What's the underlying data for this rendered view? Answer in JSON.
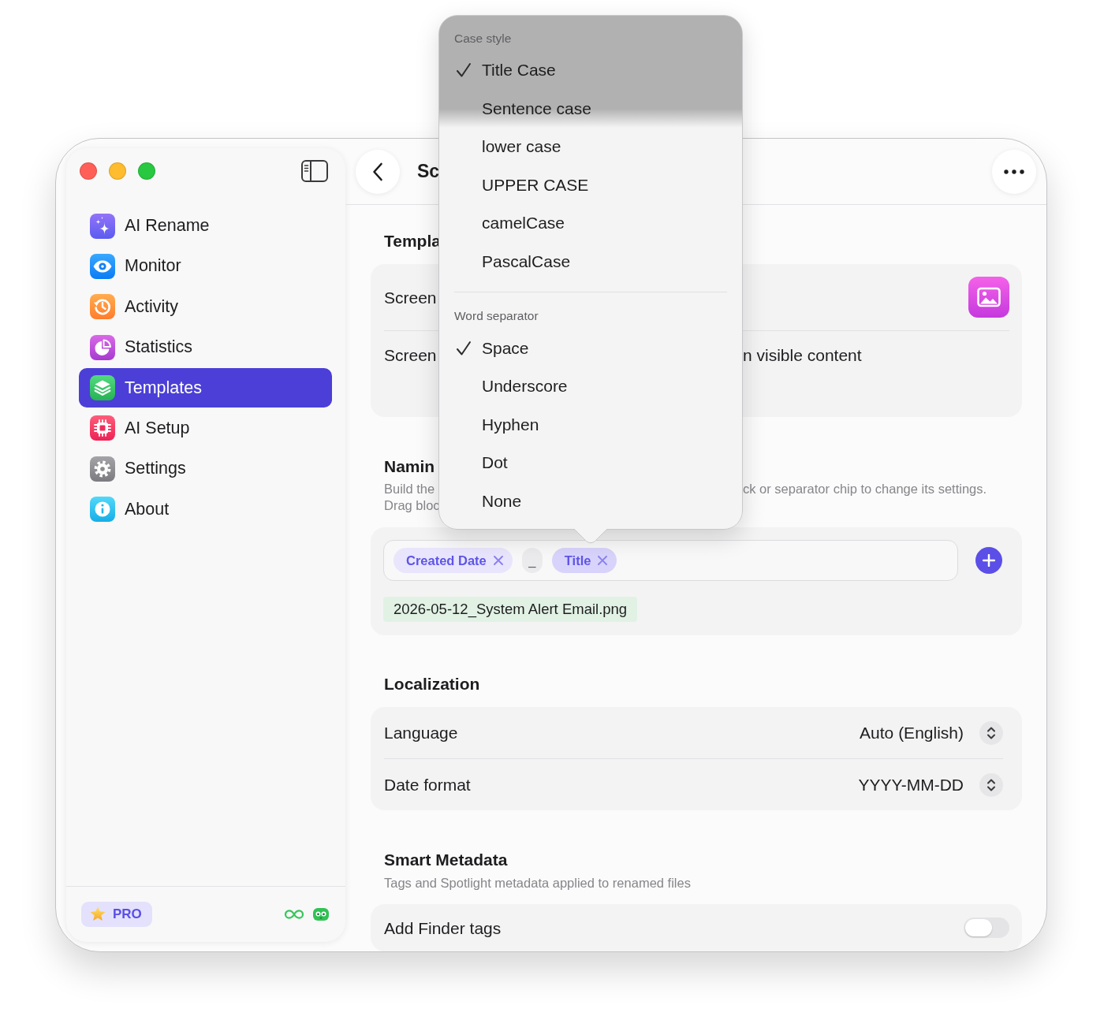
{
  "sidebar": {
    "items": [
      {
        "label": "AI Rename",
        "selected": false
      },
      {
        "label": "Monitor",
        "selected": false
      },
      {
        "label": "Activity",
        "selected": false
      },
      {
        "label": "Statistics",
        "selected": false
      },
      {
        "label": "Templates",
        "selected": true
      },
      {
        "label": "AI Setup",
        "selected": false
      },
      {
        "label": "Settings",
        "selected": false
      },
      {
        "label": "About",
        "selected": false
      }
    ],
    "badge": "PRO"
  },
  "header": {
    "title": "Sc"
  },
  "template_section": {
    "title": "Templa",
    "rows": [
      {
        "kind": "icon_picker",
        "label": "Screen"
      },
      {
        "kind": "text",
        "label": "Screen",
        "value": "n visible content"
      }
    ]
  },
  "naming_section": {
    "title": "Namin",
    "description_left": [
      "Build the",
      "Drag bloc"
    ],
    "description_right": "ck or separator chip to change its settings.",
    "tokens": [
      {
        "kind": "block",
        "label": "Created Date",
        "selected": false
      },
      {
        "kind": "separator",
        "label": "_",
        "selected": false
      },
      {
        "kind": "block",
        "label": "Title",
        "selected": true
      }
    ],
    "preview": "2026-05-12_System Alert Email.png"
  },
  "localization": {
    "title": "Localization",
    "rows": [
      {
        "label": "Language",
        "value": "Auto (English)"
      },
      {
        "label": "Date format",
        "value": "YYYY-MM-DD"
      }
    ]
  },
  "smart_metadata": {
    "title": "Smart Metadata",
    "subtitle": "Tags and Spotlight metadata applied to renamed files",
    "rows": [
      {
        "label": "Add Finder tags",
        "on": false
      }
    ]
  },
  "popup_menu": {
    "groups": [
      {
        "heading": "Case style",
        "items": [
          {
            "label": "Title Case",
            "checked": true
          },
          {
            "label": "Sentence case",
            "checked": false
          },
          {
            "label": "lower case",
            "checked": false
          },
          {
            "label": "UPPER CASE",
            "checked": false
          },
          {
            "label": "camelCase",
            "checked": false
          },
          {
            "label": "PascalCase",
            "checked": false
          }
        ]
      },
      {
        "heading": "Word separator",
        "items": [
          {
            "label": "Space",
            "checked": true
          },
          {
            "label": "Underscore",
            "checked": false
          },
          {
            "label": "Hyphen",
            "checked": false
          },
          {
            "label": "Dot",
            "checked": false
          },
          {
            "label": "None",
            "checked": false
          }
        ]
      }
    ]
  }
}
